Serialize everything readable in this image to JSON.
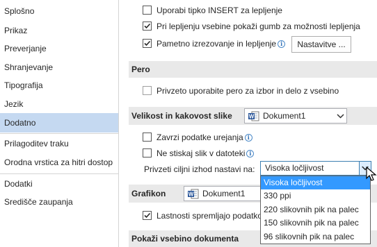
{
  "sidebar": {
    "items": [
      {
        "label": "Splošno"
      },
      {
        "label": "Prikaz"
      },
      {
        "label": "Preverjanje"
      },
      {
        "label": "Shranjevanje"
      },
      {
        "label": "Tipografija"
      },
      {
        "label": "Jezik"
      },
      {
        "label": "Dodatno",
        "active": true
      },
      {
        "label": "Prilagoditev traku"
      },
      {
        "label": "Orodna vrstica za hitri dostop"
      },
      {
        "label": "Dodatki"
      },
      {
        "label": "Središče zaupanja"
      }
    ]
  },
  "paste": {
    "insert_key": {
      "label": "Uporabi tipko INSERT za lepljenje",
      "checked": false
    },
    "show_paste_button": {
      "label": "Pri lepljenju vsebine pokaži gumb za možnosti lepljenja",
      "checked": true
    },
    "smart_cut": {
      "label": "Pametno izrezovanje in lepljenje",
      "checked": true,
      "settings_button": "Nastavitve ..."
    }
  },
  "pen": {
    "header": "Pero",
    "use_pen": {
      "label": "Privzeto uporabite pero za izbor in delo z vsebino",
      "checked": false,
      "disabled": true
    }
  },
  "image_size": {
    "header": "Velikost in kakovost slike",
    "document": "Dokument1",
    "discard_edit": {
      "label": "Zavrzi podatke urejanja",
      "checked": false
    },
    "no_compress": {
      "label": "Ne stiskaj slik v datoteki",
      "checked": false
    },
    "default_target_label": "Privzeti ciljni izhod nastavi na:",
    "default_target_value": "Visoka ločljivost",
    "options": [
      {
        "label": "Visoka ločljivost",
        "selected": true
      },
      {
        "label": "330 ppi"
      },
      {
        "label": "220 slikovnih pik na palec"
      },
      {
        "label": "150 slikovnih pik na palec"
      },
      {
        "label": "96 slikovnih pik na palec"
      }
    ]
  },
  "chart": {
    "header": "Grafikon",
    "document": "Dokument1",
    "properties_follow": {
      "label": "Lastnosti spremljajo podatko",
      "checked": true
    }
  },
  "show_content": {
    "header": "Pokaži vsebino dokumenta"
  },
  "colors": {
    "active_sidebar": "#c5d9f1",
    "section_header": "#e9e9e9",
    "dropdown_selected": "#3399ff"
  }
}
